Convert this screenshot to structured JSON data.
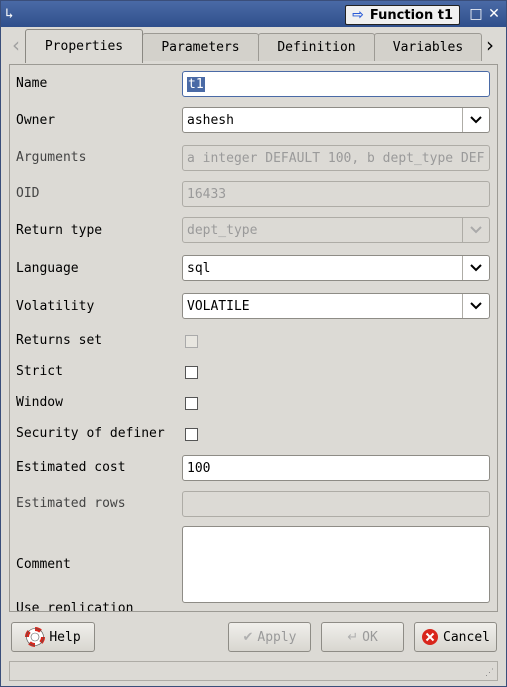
{
  "window": {
    "title": "Function t1"
  },
  "tabs": [
    {
      "label": "Properties",
      "active": true
    },
    {
      "label": "Parameters",
      "active": false
    },
    {
      "label": "Definition",
      "active": false
    },
    {
      "label": "Variables",
      "active": false
    }
  ],
  "form": {
    "name_label": "Name",
    "name_value": "t1",
    "owner_label": "Owner",
    "owner_value": "ashesh",
    "arguments_label": "Arguments",
    "arguments_value": "a integer DEFAULT 100, b dept_type DEF",
    "oid_label": "OID",
    "oid_value": "16433",
    "return_type_label": "Return type",
    "return_type_value": "dept_type",
    "language_label": "Language",
    "language_value": "sql",
    "volatility_label": "Volatility",
    "volatility_value": "VOLATILE",
    "returns_set_label": "Returns set",
    "strict_label": "Strict",
    "window_label": "Window",
    "security_label": "Security of definer",
    "est_cost_label": "Estimated cost",
    "est_cost_value": "100",
    "est_rows_label": "Estimated rows",
    "est_rows_value": "",
    "comment_label": "Comment",
    "comment_value": "",
    "replication_label": "Use replication"
  },
  "buttons": {
    "help": "Help",
    "apply": "Apply",
    "ok": "OK",
    "cancel": "Cancel"
  },
  "colors": {
    "titlebar": "#2f4f8c",
    "selection": "#4a6aa6",
    "cancel_icon": "#d9261c",
    "help_icon": "#d9261c"
  }
}
